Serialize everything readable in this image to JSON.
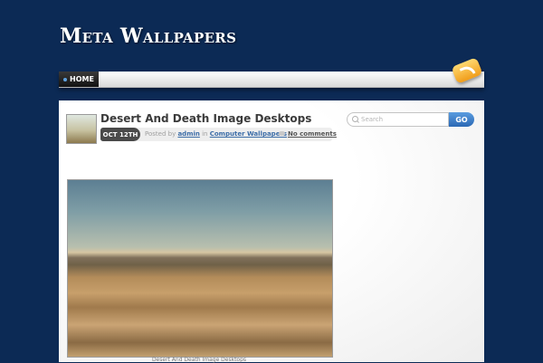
{
  "site": {
    "title": "Meta Wallpapers"
  },
  "nav": {
    "items": [
      {
        "label": "HOME"
      }
    ]
  },
  "post": {
    "title": "Desert And Death Image Desktops",
    "date_badge": "OCT 12TH",
    "meta": {
      "posted_by": "Posted by",
      "author": "admin",
      "in": "in",
      "category": "Computer Wallpapers"
    },
    "comments": "No comments",
    "image_caption": "Desert And Death Image Desktops"
  },
  "search": {
    "placeholder": "Search",
    "button_label": "GO"
  },
  "icons": {
    "rss": "rss-feed-icon",
    "search": "search-icon",
    "comment": "comment-bubble-icon"
  },
  "colors": {
    "background": "#0c2a55",
    "accent": "#2a68b4",
    "link": "#3d6ea8"
  }
}
